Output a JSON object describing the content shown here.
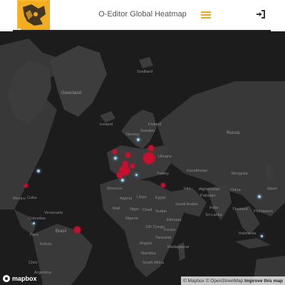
{
  "app": {
    "title": "O-Editor Global Heatmap"
  },
  "header": {
    "logo_name": "orienteering-logo",
    "menu_icon": "hamburger-menu-icon",
    "login_icon": "sign-in-icon"
  },
  "colors": {
    "accent": "#f0a81e",
    "map_bg": "#1c1c1c",
    "land": "#3a3a3a",
    "heat_red": "#c8102e",
    "heat_blue": "#9fd3f0"
  },
  "map": {
    "labels": {
      "svalbard": "Svalbard",
      "greenland": "Greenland",
      "iceland": "Iceland",
      "norway": "Norway",
      "finland": "Finland",
      "russia": "Russia",
      "kazakhstan": "Kazakhstan",
      "turkey": "Turkey",
      "iran": "Iran",
      "morocco": "Morocco",
      "algeria": "Algeria",
      "libya": "Libya",
      "egypt": "Egypt",
      "mali": "Mali",
      "niger": "Niger",
      "chad": "Chad",
      "sudan": "Sudan",
      "nigeria": "Nigeria",
      "ethiopia": "Ethiopia",
      "kenya": "Kenya",
      "angola": "Angola",
      "tanzania": "Tanzania",
      "namibia": "Namibia",
      "madagascar": "Madagascar",
      "south_africa": "South Africa",
      "brazil": "Brazil",
      "peru": "Peru",
      "bolivia": "Bolivia",
      "argentina": "Argentina",
      "chile": "Chile",
      "cuba": "Cuba",
      "mexico": "Mexico",
      "saudi": "Saudi Arabia",
      "india": "India",
      "sri_lanka": "Sri Lanka",
      "philippines": "Philippines",
      "china": "China",
      "mongolia": "Mongolia",
      "japan": "Japan",
      "thailand": "Thailand",
      "indonesia": "Indonesia",
      "dr_congo": "DR Congo",
      "venezuela": "Venezuela",
      "colombia": "Colombia",
      "ukraine": "Ukraine",
      "sweden": "Sweden",
      "pakistan": "Pakistan",
      "afghanistan": "Afghanistan"
    },
    "logo_text": "mapbox",
    "attribution": {
      "mapbox": "© Mapbox",
      "osm": "© OpenStreetMap",
      "improve": "Improve this map"
    }
  }
}
